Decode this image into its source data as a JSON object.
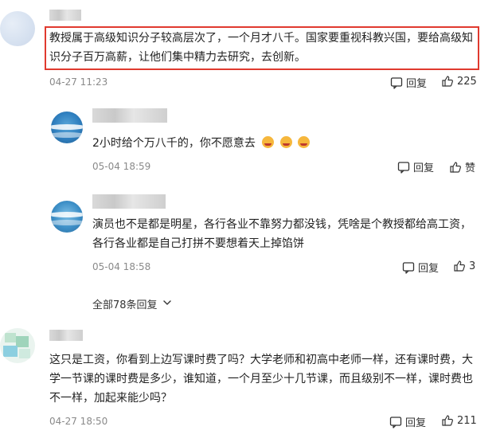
{
  "comments": [
    {
      "text_lines": [
        "教授属于高级知识分子较高层次了，一个月才八千。国家要重视科教兴国，要给高级知",
        "识分子百万高薪，让他们集中精力去研究，去创新。"
      ],
      "timestamp": "04-27 11:23",
      "reply_label": "回复",
      "like_count": "225"
    },
    {
      "text_lines": [
        "这只是工资，你看到上边写课时费了吗？大学老师和初高中老师一样，还有课时费，大",
        "学一节课的课时费是多少，谁知道，一个月至少十几节课，而且级别不一样，课时费也",
        "不一样，加起来能少吗？"
      ],
      "timestamp": "04-27 18:50",
      "reply_label": "回复",
      "like_count": "211"
    }
  ],
  "replies": [
    {
      "text": "2小时给个万八千的，你不愿意去",
      "emoji_count": 3,
      "timestamp": "05-04 18:59",
      "reply_label": "回复",
      "like_label": "赞"
    },
    {
      "text_lines": [
        "演员也不是都是明星，各行各业不靠努力都没钱，凭啥是个教授都给高工资，",
        "各行各业都是自己打拼不要想着天上掉馅饼"
      ],
      "timestamp": "05-04 18:58",
      "reply_label": "回复",
      "like_count": "3"
    }
  ],
  "expand": {
    "label": "全部78条回复"
  },
  "colors": {
    "highlight": "#e03a2f",
    "timestamp": "#8a8a8a"
  }
}
